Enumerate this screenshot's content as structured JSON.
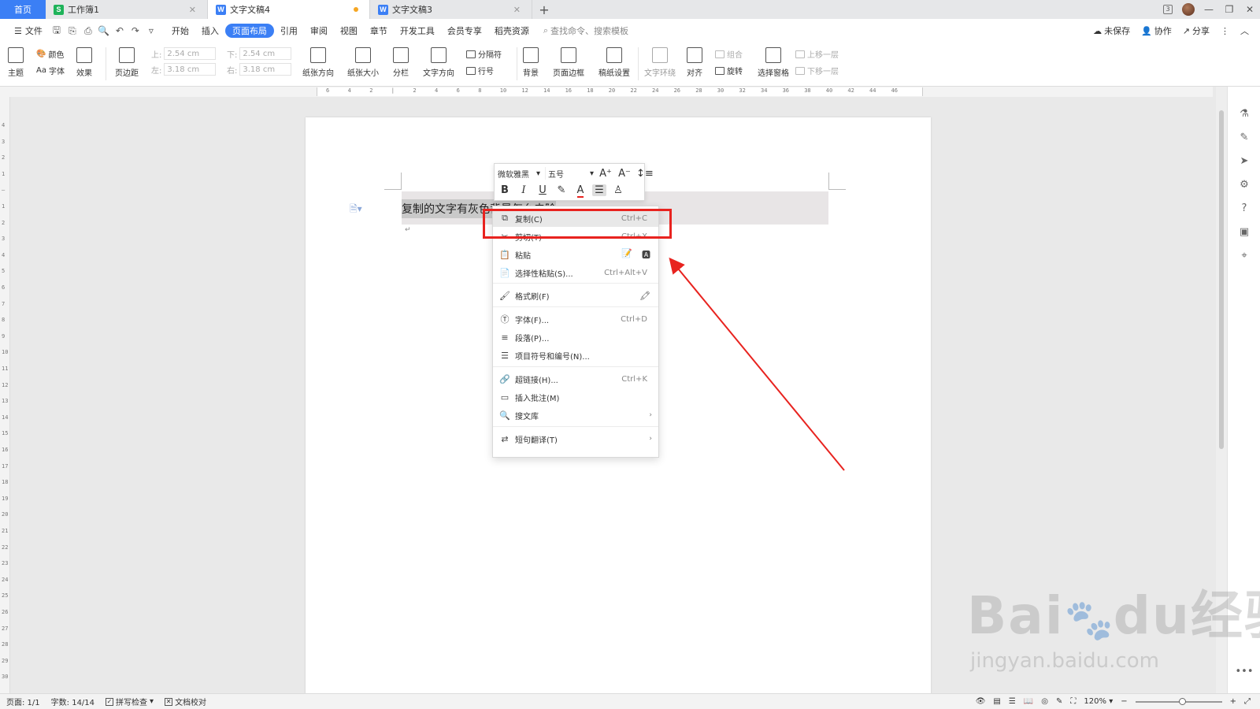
{
  "tabs": {
    "home": "首页",
    "items": [
      {
        "icon": "S",
        "label": "工作簿1",
        "state": "close"
      },
      {
        "icon": "W",
        "label": "文字文稿4",
        "state": "modified"
      },
      {
        "icon": "W",
        "label": "文字文稿3",
        "state": "close"
      }
    ],
    "new_tab": "+",
    "badge": "3"
  },
  "menu": {
    "file": "文件",
    "items": [
      "开始",
      "插入",
      "页面布局",
      "引用",
      "审阅",
      "视图",
      "章节",
      "开发工具",
      "会员专享",
      "稻壳资源"
    ],
    "active_index": 2,
    "search": "查找命令、搜索模板",
    "unsaved": "未保存",
    "collab": "协作",
    "share": "分享"
  },
  "ribbon": {
    "theme": "主题",
    "colors": "颜色",
    "fonts": "字体",
    "effects": "效果",
    "margins": "页边距",
    "margin_top_label": "上:",
    "margin_top": "2.54 cm",
    "margin_bottom_label": "下:",
    "margin_bottom": "2.54 cm",
    "margin_left_label": "左:",
    "margin_left": "3.18 cm",
    "margin_right_label": "右:",
    "margin_right": "3.18 cm",
    "orientation": "纸张方向",
    "size": "纸张大小",
    "columns": "分栏",
    "text_dir": "文字方向",
    "breaks": "分隔符",
    "line_num": "行号",
    "background": "背景",
    "page_border": "页面边框",
    "manuscript": "稿纸设置",
    "text_wrap": "文字环绕",
    "align": "对齐",
    "group": "组合",
    "rotate": "旋转",
    "selection_pane": "选择窗格",
    "bring_fwd": "上移一层",
    "send_back": "下移一层"
  },
  "ruler": {
    "h_ticks": [
      "6",
      "4",
      "2",
      "",
      "2",
      "4",
      "6",
      "8",
      "10",
      "12",
      "14",
      "16",
      "18",
      "20",
      "22",
      "24",
      "26",
      "28",
      "30",
      "32",
      "34",
      "36",
      "38",
      "40",
      "42",
      "44",
      "46"
    ],
    "v_ticks": [
      "4",
      "3",
      "2",
      "1",
      "",
      "1",
      "2",
      "3",
      "4",
      "5",
      "6",
      "7",
      "8",
      "9",
      "10",
      "11",
      "12",
      "13",
      "14",
      "15",
      "16",
      "17",
      "18",
      "19",
      "20",
      "21",
      "22",
      "23",
      "24",
      "25",
      "26",
      "27",
      "28",
      "29",
      "30"
    ]
  },
  "document": {
    "text": "复制的文字有灰色背景怎么去除",
    "para_mark": "↵"
  },
  "minibar": {
    "font": "微软雅黑",
    "size": "五号",
    "bold": "B",
    "italic": "I",
    "underline": "U",
    "font_color": "A"
  },
  "context_menu": [
    {
      "icon": "⧉",
      "label": "复制(C)",
      "shortcut": "Ctrl+C",
      "highlight": true
    },
    {
      "icon": "✂",
      "label": "剪切(T)",
      "shortcut": "Ctrl+X"
    },
    {
      "icon": "📋",
      "label": "粘贴",
      "shortcut": ""
    },
    {
      "icon": "📄",
      "label": "选择性粘贴(S)...",
      "shortcut": "Ctrl+Alt+V"
    },
    {
      "icon": "🖌",
      "label": "格式刷(F)",
      "shortcut": ""
    },
    {
      "icon": "Ⓣ",
      "label": "字体(F)...",
      "shortcut": "Ctrl+D"
    },
    {
      "icon": "≡",
      "label": "段落(P)...",
      "shortcut": ""
    },
    {
      "icon": "☰",
      "label": "项目符号和编号(N)...",
      "shortcut": ""
    },
    {
      "icon": "🔗",
      "label": "超链接(H)...",
      "shortcut": "Ctrl+K"
    },
    {
      "icon": "▭",
      "label": "插入批注(M)",
      "shortcut": ""
    },
    {
      "icon": "🔍",
      "label": "搜文库",
      "shortcut": "",
      "submenu": "›"
    },
    {
      "icon": "⇄",
      "label": "短句翻译(T)",
      "shortcut": "",
      "submenu": "›"
    }
  ],
  "status": {
    "page": "页面: 1/1",
    "words": "字数: 14/14",
    "spell": "拼写检查",
    "proof": "文档校对",
    "zoom": "120%",
    "zoom_fraction": 0.55
  },
  "watermark": {
    "brand": "Bai",
    "brand2": "du",
    "cn": "经验",
    "url": "jingyan.baidu.com"
  },
  "colors": {
    "accent": "#3b7ff5",
    "annotation": "#e8231f"
  }
}
